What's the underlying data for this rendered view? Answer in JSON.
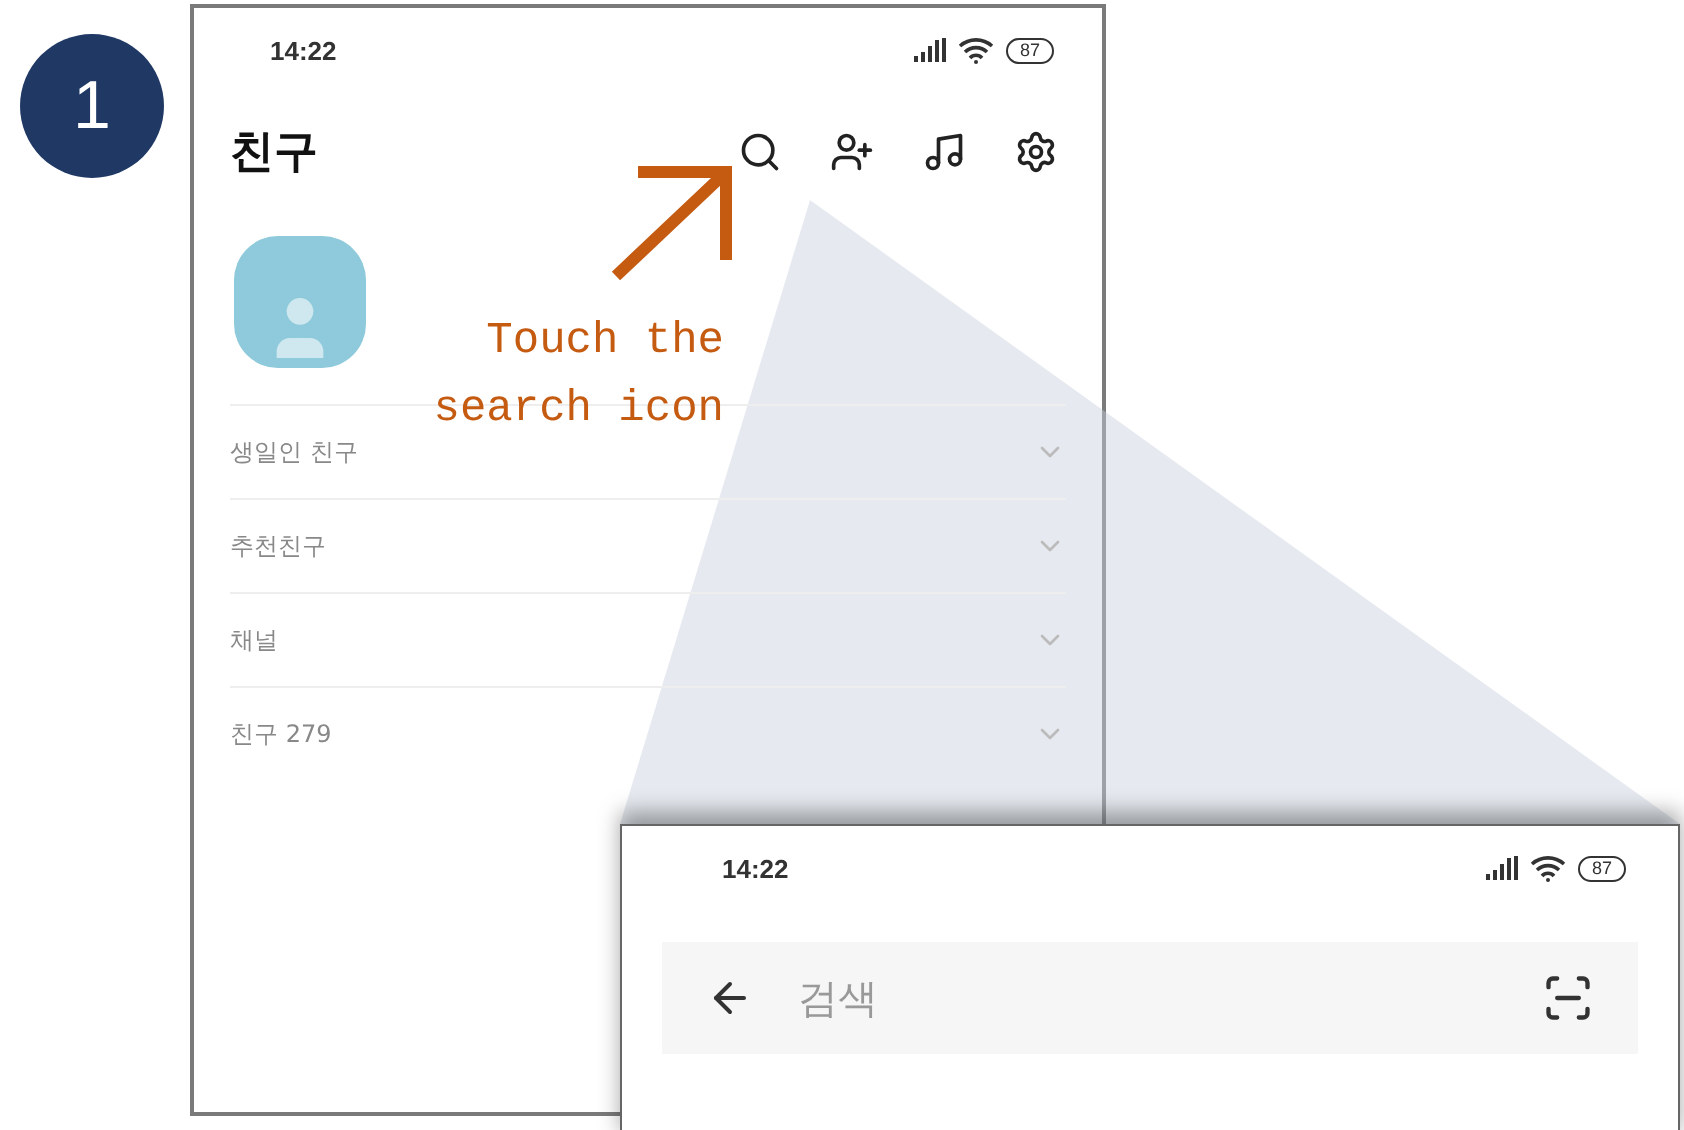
{
  "step_badge": "1",
  "callout": {
    "lines": [
      "Touch the",
      "search icon"
    ]
  },
  "friends_screen": {
    "status_bar": {
      "time": "14:22",
      "battery": "87"
    },
    "title": "친구",
    "sections": [
      {
        "label": "생일인 친구"
      },
      {
        "label": "추천친구"
      },
      {
        "label": "채널"
      },
      {
        "label": "친구 279"
      }
    ]
  },
  "search_screen": {
    "status_bar": {
      "time": "14:22",
      "battery": "87"
    },
    "search": {
      "placeholder": "검색"
    }
  }
}
